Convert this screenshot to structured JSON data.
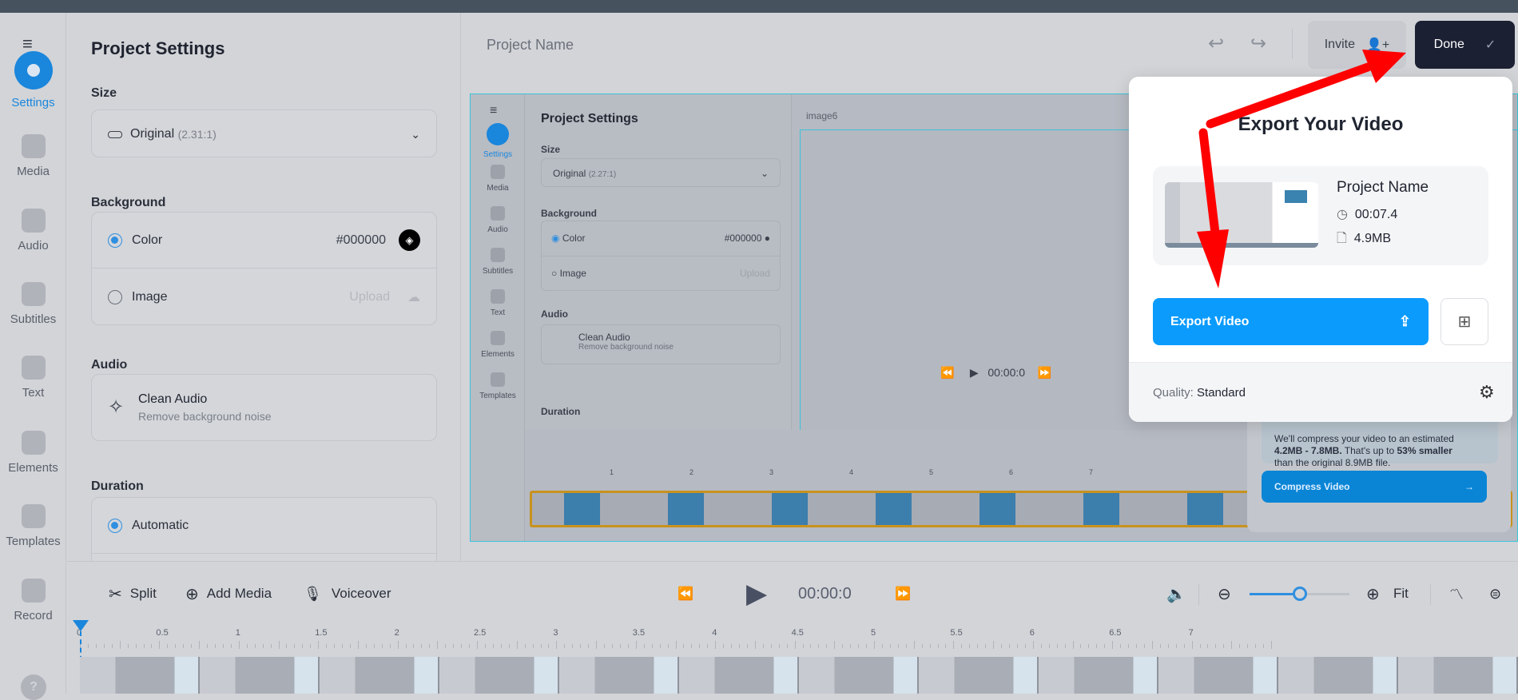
{
  "rail": {
    "items": [
      {
        "label": "Settings",
        "icon": "gear-icon",
        "active": true
      },
      {
        "label": "Media",
        "icon": "plus-icon"
      },
      {
        "label": "Audio",
        "icon": "music-note-icon"
      },
      {
        "label": "Subtitles",
        "icon": "subtitles-icon"
      },
      {
        "label": "Text",
        "icon": "text-icon"
      },
      {
        "label": "Elements",
        "icon": "elements-icon"
      },
      {
        "label": "Templates",
        "icon": "templates-icon"
      },
      {
        "label": "Record",
        "icon": "camera-icon"
      }
    ],
    "help": "?"
  },
  "panel": {
    "title": "Project Settings",
    "size_label": "Size",
    "size_value": "Original",
    "size_ratio": "(2.31:1)",
    "background_label": "Background",
    "color_option": "Color",
    "color_value": "#000000",
    "image_option": "Image",
    "upload": "Upload",
    "audio_label": "Audio",
    "clean_audio": "Clean Audio",
    "clean_audio_sub": "Remove background noise",
    "duration_label": "Duration",
    "automatic": "Automatic"
  },
  "header": {
    "project_name": "Project Name",
    "invite": "Invite",
    "done": "Done"
  },
  "popup": {
    "title": "Export Your Video",
    "project_name": "Project Name",
    "duration": "00:07.4",
    "file_size": "4.9MB",
    "export_button": "Export Video",
    "quality_label": "Quality:",
    "quality_value": "Standard"
  },
  "preview": {
    "panel_title": "Project Settings",
    "size_label": "Size",
    "size_value": "Original",
    "size_ratio": "(2.27:1)",
    "background_label": "Background",
    "color_option": "Color",
    "color_value": "#000000",
    "image_option": "Image",
    "upload": "Upload",
    "audio_label": "Audio",
    "clean_audio": "Clean Audio",
    "clean_audio_sub": "Remove background noise",
    "duration_label": "Duration",
    "canvas_name": "image6",
    "time": "00:00:0",
    "rail": [
      "Settings",
      "Media",
      "Audio",
      "Subtitles",
      "Text",
      "Elements",
      "Templates"
    ],
    "ruler": [
      "1",
      "2",
      "3",
      "4",
      "5",
      "6",
      "7"
    ],
    "compress": {
      "text1": "We'll compress your video to an estimated",
      "range": "4.2MB - 7.8MB.",
      "text2": " That's up to ",
      "pct": "53% smaller",
      "text3": "than the original 8.9MB file.",
      "button": "Compress Video"
    }
  },
  "toolbar": {
    "split": "Split",
    "add_media": "Add Media",
    "voiceover": "Voiceover",
    "time": "00:00:0",
    "fit": "Fit",
    "zoom_level": 0.5
  },
  "ruler": {
    "labels": [
      "0",
      "0.5",
      "1",
      "1.5",
      "2",
      "2.5",
      "3",
      "3.5",
      "4",
      "4.5",
      "5",
      "5.5",
      "6",
      "6.5",
      "7"
    ]
  },
  "colors": {
    "accent": "#0a9bfd",
    "done_bg": "#1c2033",
    "arrow": "#ff0000"
  }
}
